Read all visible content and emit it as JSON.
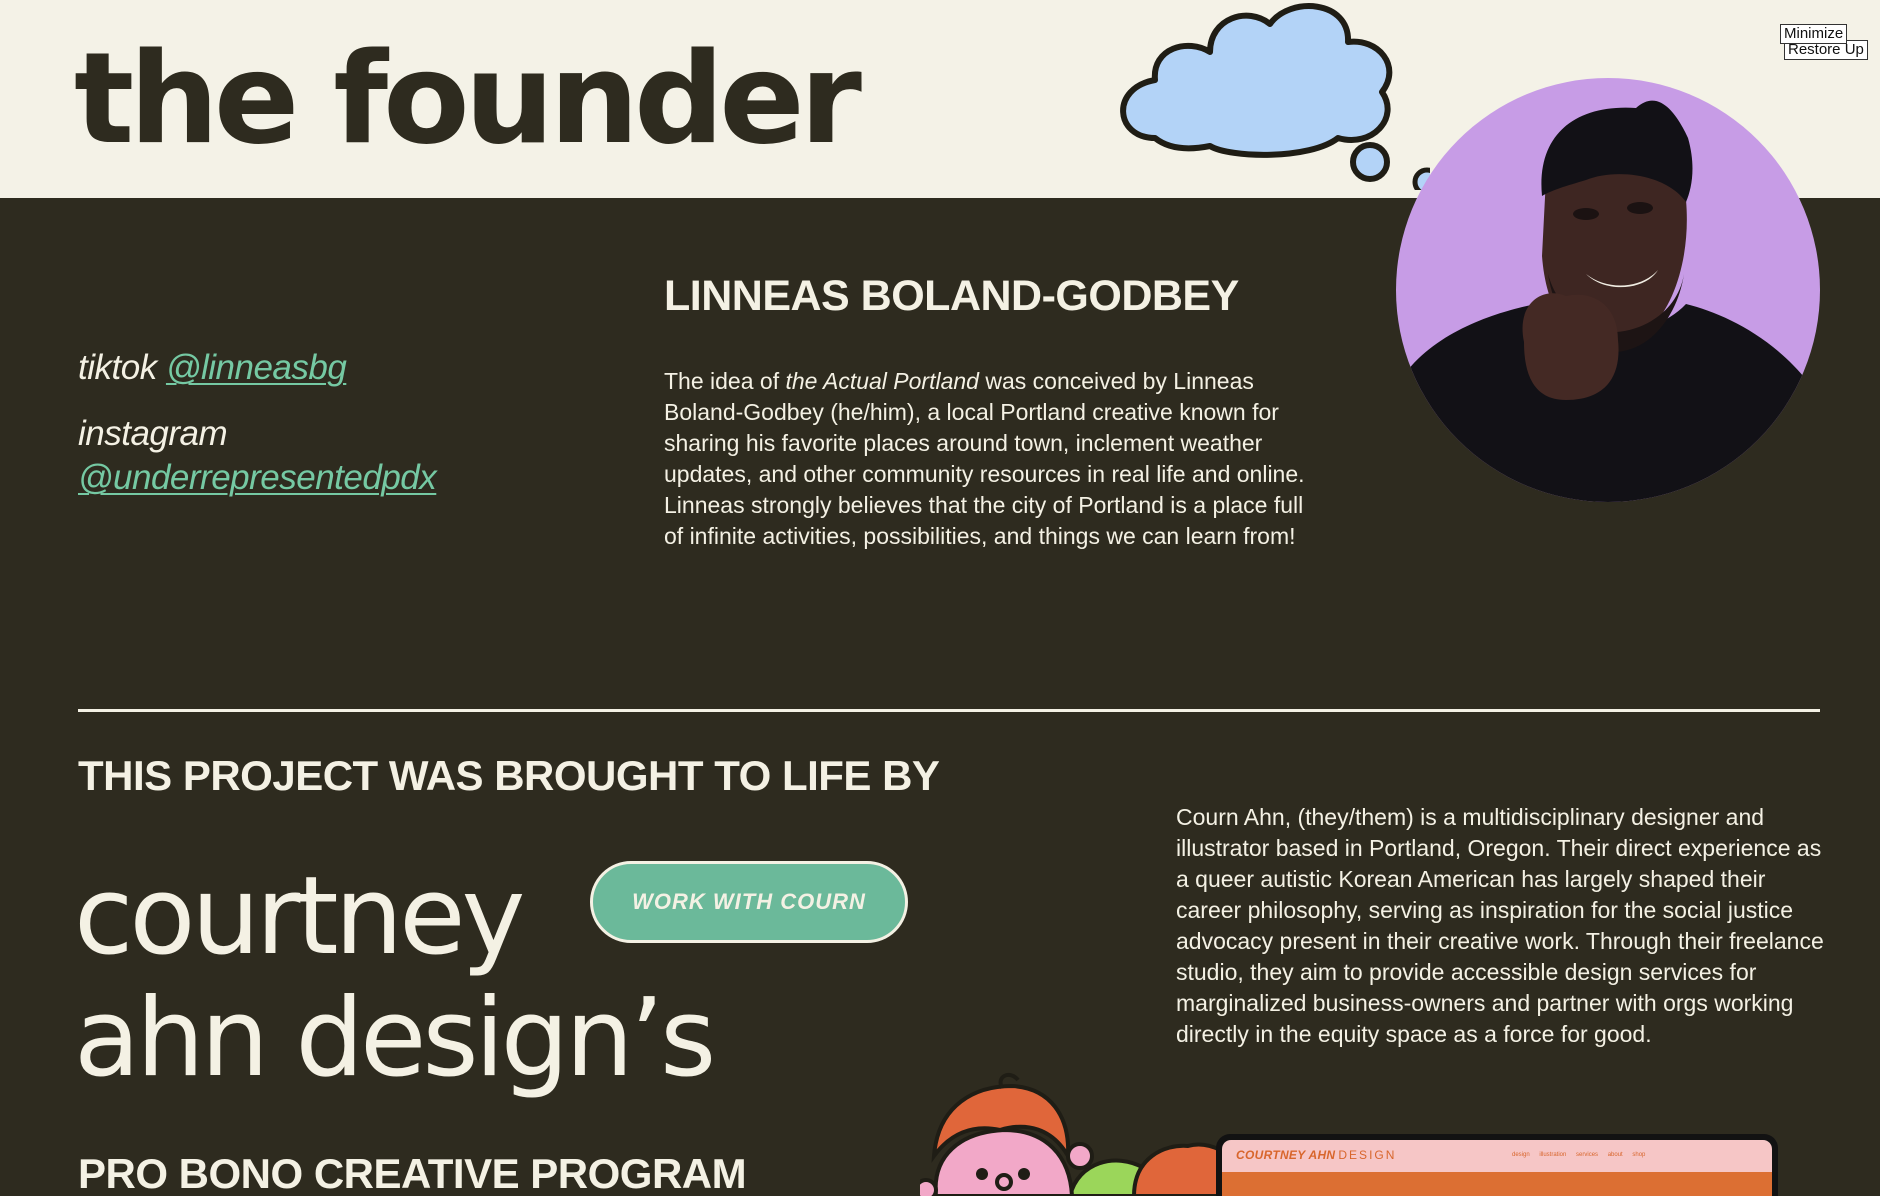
{
  "window": {
    "minimize_label": "Minimize",
    "restore_label": "Restore Up"
  },
  "founder": {
    "title": "the founder",
    "name": "LINNEAS BOLAND-GODBEY",
    "bio_before": "The idea of ",
    "bio_emphasis": "the Actual Portland",
    "bio_after": " was conceived by Linneas Boland-Godbey (he/him), a local Portland creative known for sharing his favorite places around town, inclement weather updates, and other community resources in real life and online. Linneas strongly believes that the city of Portland is a place full of infinite activities, possibilities, and things we can learn from!",
    "socials": [
      {
        "platform": "tiktok",
        "handle": "@linneasbg"
      },
      {
        "platform": "instagram",
        "handle": "@underrepresentedpdx"
      }
    ]
  },
  "credits": {
    "heading": "THIS PROJECT WAS BROUGHT TO LIFE BY",
    "name_line1": "courtney",
    "name_line2": "ahn design’s",
    "program": "PRO BONO CREATIVE PROGRAM",
    "button_label": "WORK WITH COURN",
    "bio": "Courn Ahn, (they/them) is a multidisciplinary designer and illustrator based in Portland, Oregon. Their direct experience as a queer autistic Korean American has largely shaped their career philosophy, serving as inspiration for the social justice advocacy present in their creative work. Through their freelance studio, they aim to provide accessible design services for marginalized business-owners and partner with orgs working directly in the equity space as a force for good."
  },
  "laptop_preview": {
    "logo": "COURTNEY AHN",
    "logo_sub": "DESIGN",
    "nav": "design illustration services about shop"
  },
  "colors": {
    "dark_background": "#2e2b1f",
    "light_band": "#f4f2e7",
    "accent_green": "#6bb99a",
    "link_green": "#75c9a3",
    "cloud_blue": "#b3d3f7",
    "portrait_purple": "#c79ce6"
  }
}
